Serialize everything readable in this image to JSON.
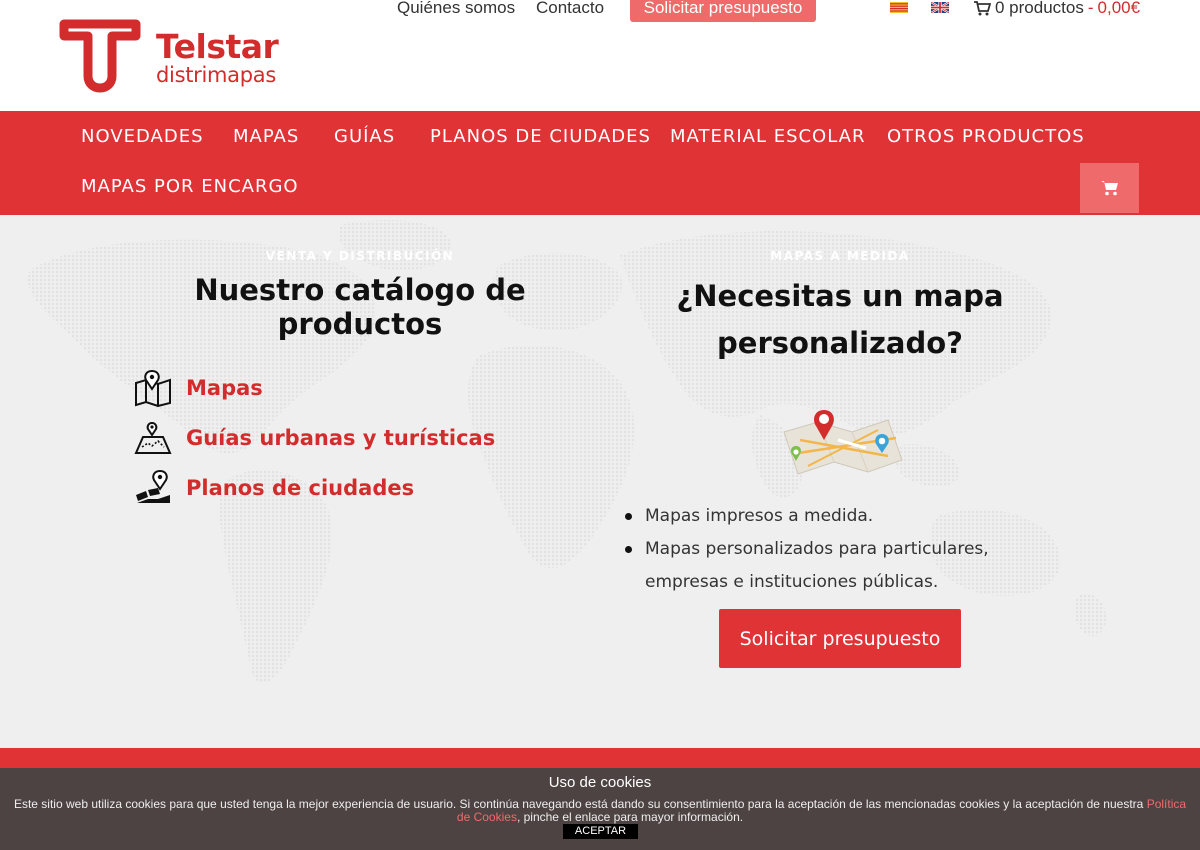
{
  "brand": {
    "name": "Telstar",
    "sub": "distrimapas",
    "color": "#d32c2c"
  },
  "topnav": {
    "about": "Quiénes somos",
    "contact": "Contacto",
    "quote": "Solicitar presupuesto",
    "cart_count": "0 productos",
    "cart_sep": "-",
    "cart_total": "0,00€"
  },
  "mainnav": {
    "items": [
      "NOVEDADES",
      "MAPAS",
      "GUÍAS",
      "PLANOS DE CIUDADES",
      "MATERIAL ESCOLAR",
      "OTROS PRODUCTOS",
      "MAPAS POR ENCARGO"
    ],
    "accent": "#e03336"
  },
  "hero": {
    "left_eyebrow": "VENTA Y DISTRIBUCIÓN",
    "left_title": "Nuestro catálogo de productos",
    "categories": [
      {
        "label": "Mapas",
        "icon": "map-pin-icon"
      },
      {
        "label": "Guías urbanas y turísticas",
        "icon": "terrain-map-icon"
      },
      {
        "label": "Planos de ciudades",
        "icon": "city-plan-icon"
      }
    ],
    "right_eyebrow": "MAPAS A MEDIDA",
    "right_title_line1": "¿Necesitas un mapa",
    "right_title_line2": "personalizado?",
    "bullets": [
      "Mapas impresos a medida.",
      "Mapas personalizados para particulares, empresas e instituciones públicas."
    ],
    "cta": "Solicitar presupuesto"
  },
  "cookies": {
    "title": "Uso de cookies",
    "text": "Este sitio web utiliza cookies para que usted tenga la mejor experiencia de usuario. Si continúa navegando está dando su consentimiento para la aceptación de las mencionadas cookies y la aceptación de nuestra",
    "link": "Política de Cookies",
    "text_after": ", pinche el enlace para mayor información.",
    "accept": "ACEPTAR"
  }
}
